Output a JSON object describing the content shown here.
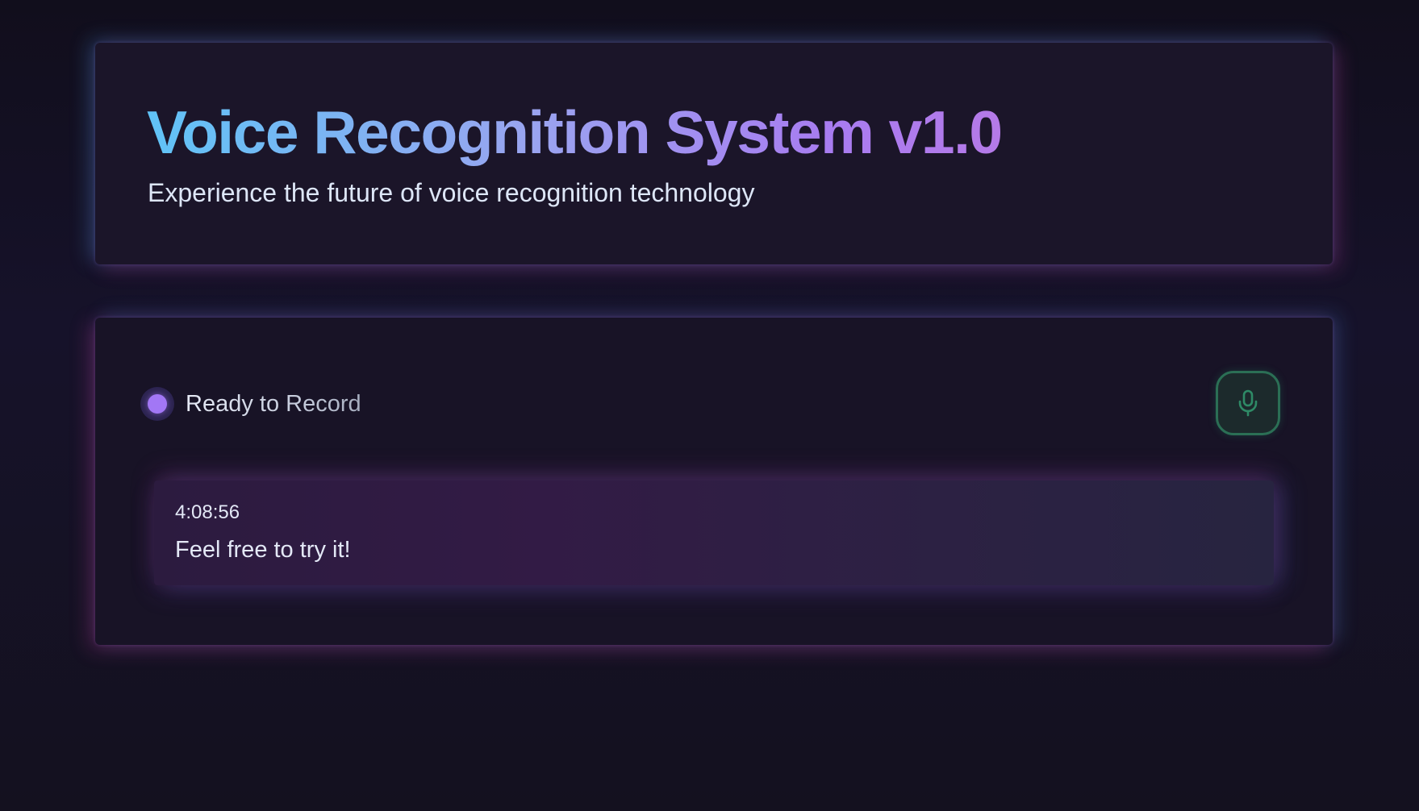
{
  "header": {
    "title": "Voice Recognition System v1.0",
    "subtitle": "Experience the future of voice recognition technology"
  },
  "recorder": {
    "status_text": "Ready to Record",
    "status_color": "#a277f5",
    "mic_button_icon": "microphone-icon",
    "mic_button_color": "#2b6f55"
  },
  "transcript": {
    "entries": [
      {
        "time": "4:08:56",
        "text": "Feel free to try it!"
      }
    ]
  },
  "colors": {
    "background": "#14111f",
    "card": "#1b1529",
    "title_gradient_start": "#60c3f6",
    "title_gradient_end": "#b57ae8"
  }
}
